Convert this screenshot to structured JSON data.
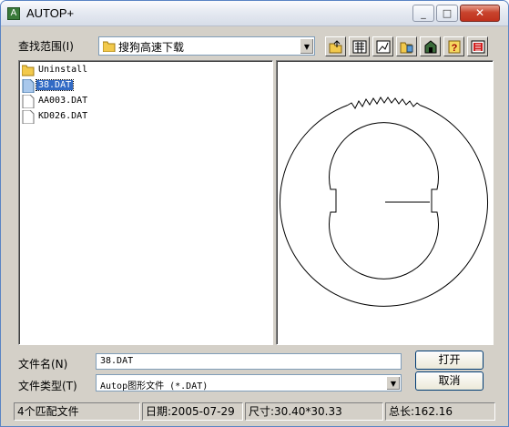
{
  "window": {
    "title": "AUTOP+",
    "icon": "autop-app-icon"
  },
  "lookin": {
    "label": "查找范围(I)",
    "value": "搜狗高速下载"
  },
  "toolbar": {
    "icons": [
      "up-folder-icon",
      "list-view-icon",
      "preview-toggle-icon",
      "open-folder-icon",
      "delete-file-icon",
      "help-icon",
      "exit-icon"
    ]
  },
  "files": [
    {
      "name": "Uninstall",
      "type": "folder",
      "selected": false
    },
    {
      "name": "38.DAT",
      "type": "file",
      "selected": true
    },
    {
      "name": "AA003.DAT",
      "type": "file",
      "selected": false
    },
    {
      "name": "KD026.DAT",
      "type": "file",
      "selected": false
    }
  ],
  "filename": {
    "label": "文件名(N)",
    "value": "38.DAT"
  },
  "filetype": {
    "label": "文件类型(T)",
    "value": "Autop图形文件 (*.DAT)"
  },
  "buttons": {
    "open": "打开",
    "cancel": "取消"
  },
  "status": {
    "count": "4个匹配文件",
    "date": "日期:2005-07-29",
    "size": "尺寸:30.40*30.33",
    "length": "总长:162.16"
  },
  "colors": {
    "selection": "#316ac5",
    "face": "#d4d0c8",
    "close": "#c8442e"
  }
}
